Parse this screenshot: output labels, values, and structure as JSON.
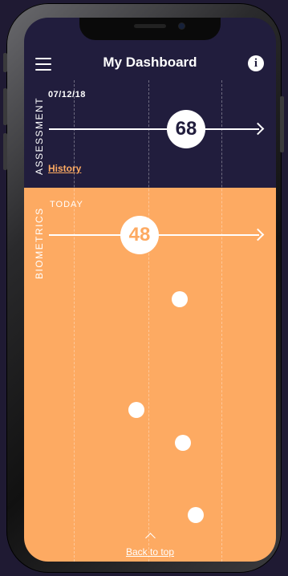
{
  "header": {
    "title": "My Dashboard",
    "menu_icon": "hamburger-menu-icon",
    "info_icon": "info-icon",
    "info_glyph": "i"
  },
  "assessment": {
    "label": "ASSESSMENT",
    "date": "07/12/18",
    "score": "68",
    "history_link": "History"
  },
  "biometrics": {
    "label": "BIOMETRICS",
    "period": "TODAY",
    "score": "48",
    "data_points": 4
  },
  "footer": {
    "back_to_top": "Back to top",
    "chevron_icon": "chevron-up-icon"
  },
  "colors": {
    "dark_navy": "#211d3d",
    "orange": "#fdaa62",
    "white": "#ffffff"
  }
}
